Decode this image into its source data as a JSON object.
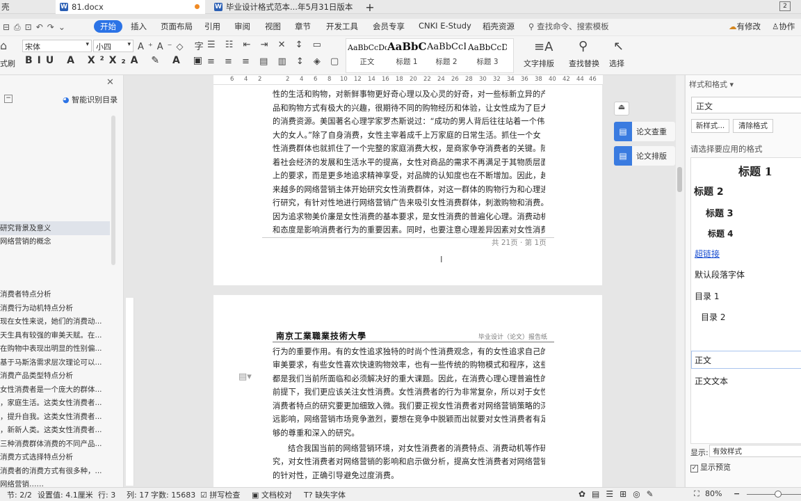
{
  "tabs": {
    "left_partial": "壳",
    "doc1": "81.docx",
    "doc2": "毕业设计格式范本...年5月31日版本",
    "add": "+",
    "badge": "2"
  },
  "menu": {
    "items": [
      "开始",
      "插入",
      "页面布局",
      "引用",
      "审阅",
      "视图",
      "章节",
      "开发工具",
      "会员专享",
      "CNKI E-Study",
      "稻壳资源"
    ],
    "search": "查找命令、搜索模板",
    "changes": "有修改",
    "collab": "协作"
  },
  "ribbon": {
    "format_painter": "式刷",
    "font": "宋体",
    "size": "小四",
    "styles": [
      {
        "preview": "AaBbCcDd",
        "label": "正文"
      },
      {
        "preview": "AaBbCc",
        "label": "标题 1"
      },
      {
        "preview": "AaBbCcD",
        "label": "标题 2"
      },
      {
        "preview": "AaBbCcD",
        "label": "标题 3"
      }
    ],
    "text_layout": "文字排版",
    "find_replace": "查找替换",
    "select": "选择"
  },
  "ruler": {
    "ticks": [
      "6",
      "4",
      "2",
      "",
      "2",
      "4",
      "6",
      "8",
      "10",
      "12",
      "14",
      "16",
      "18",
      "20",
      "22",
      "24",
      "26",
      "28",
      "30",
      "32",
      "34",
      "36",
      "38",
      "40",
      "42",
      "44",
      "46"
    ]
  },
  "nav": {
    "smart_toc": "智能识别目录",
    "items": [
      "研究背景及意义",
      "网络营销的概念",
      "消费者特点分析",
      "消费行为动机特点分析",
      "现在女性来说，她们的消费动...",
      "天生具有较强的审美天赋。在...",
      "在购物中表现出明显的性别偏...",
      "基于马斯洛需求层次理论可以...",
      "消费产品类型特点分析",
      "女性消费者是一个庞大的群体...",
      "，家庭生活。这类女性消费者...",
      "，提升自我。这类女性消费者...",
      "，新新人类。这类女性消费者...",
      "三种消费群体消费的不同产品...",
      "消费方式选择特点分析",
      "消费者的消费方式有很多种，...",
      "网络营销……"
    ]
  },
  "page1": {
    "lines": [
      "性的生活和购物，对新鲜事物更好奇心理以及心灵的好奇，对一些标新立异的产",
      "品和购物方式有极大的兴趣，很期待不同的购物经历和体验，让女性成为了巨大",
      "的消费资源。美国著名心理学家罗杰斯说过：“成功的男人背后往往站着一个伟",
      "大的女人。”除了自身消费，女性主宰着成千上万家庭的日常生活。抓住一个女",
      "性消费群体也就抓住了一个完整的家庭消费大权，是商家争夺消费者的关键。随",
      "着社会经济的发展和生活水平的提高，女性对商品的需求不再满足于其物质层面",
      "上的要求，而是更多地追求精神享受，对品牌的认知度也在不断增加。因此，越",
      "来越多的网络营销主体开始研究女性消费群体，对这一群体的购物行为和心理进",
      "行研究，有针对性地进行网络营销广告来吸引女性消费群体，刺激购物和消费。",
      "因为追求物美价廉是女性消费的基本要求，是女性消费的普遍化心理。消费动机",
      "和态度是影响消费者行为的重要因素。同时，也要注意心理差异因素对女性消费"
    ],
    "footer": "共 21页 · 第 1页"
  },
  "page2": {
    "school": "南京工業職業技術大學",
    "header_right": "毕业设计（论文）报告纸",
    "lines": [
      "行为的重要作用。有的女性追求独特的时尚个性消费观念，有的女性追求自己的",
      "审美要求，有些女性喜欢快速购物效率，也有一些传统的购物模式和程序，这些",
      "都是我们当前所面临和必须解决好的重大课题。因此，在消费心理心理普遍性的",
      "前提下，我们更应该关注女性消费。女性消费者的行为非常复杂，所以对于女性",
      "消费者特点的研究要更加细致入微。我们要正视女性消费者对网络营销策略的深",
      "远影响，网络营销市场竞争激烈，要想在竞争中脱颖而出就要对女性消费者有足",
      "够的尊重和深入的研究。",
      "结合我国当前的网络营销环境，对女性消费者的消费特点、消费动机等作研",
      "究，对女性消费者对网络营销的影响和启示做分析，提高女性消费者对网络营销",
      "的针对性，正确引导避免过度消费。"
    ]
  },
  "float_buttons": {
    "check": "论文查重",
    "layout": "论文排版"
  },
  "rpanel": {
    "title": "样式和格式",
    "current": "正文",
    "new_style": "新样式...",
    "clear_format": "清除格式",
    "apply_prompt": "请选择要应用的格式",
    "styles": [
      "标题 1",
      "标题 2",
      "标题 3",
      "标题 4",
      "超链接",
      "默认段落字体",
      "目录 1",
      "目录 2",
      "正文",
      "正文文本"
    ],
    "show_label": "显示:",
    "show_value": "有效样式",
    "preview_label": "显示预览"
  },
  "status": {
    "section": "节: 2/2",
    "setting": "设置值: 4.1厘米",
    "row": "行: 3",
    "col": "列: 17",
    "words": "字数: 15683",
    "spell": "拼写检查",
    "proof": "文档校对",
    "missing_font": "缺失字体",
    "zoom": "80%"
  }
}
